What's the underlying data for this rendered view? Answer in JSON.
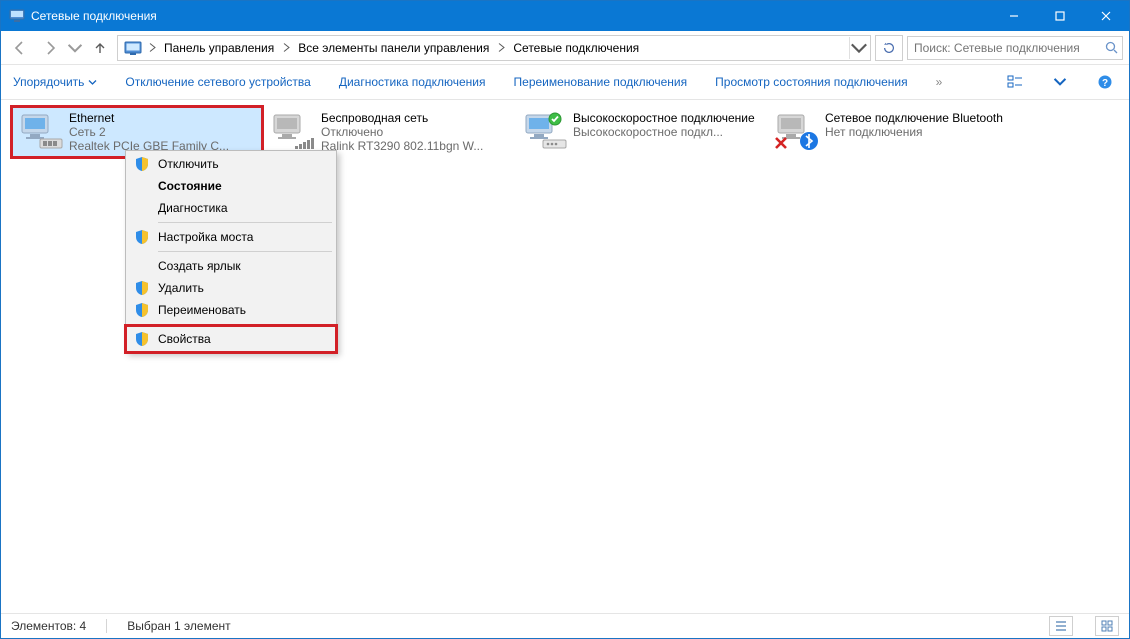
{
  "window": {
    "title": "Сетевые подключения"
  },
  "breadcrumb": {
    "item1": "Панель управления",
    "item2": "Все элементы панели управления",
    "item3": "Сетевые подключения"
  },
  "search": {
    "placeholder": "Поиск: Сетевые подключения"
  },
  "commands": {
    "organize": "Упорядочить",
    "disable": "Отключение сетевого устройства",
    "diagnose": "Диагностика подключения",
    "rename": "Переименование подключения",
    "status": "Просмотр состояния подключения"
  },
  "connections": [
    {
      "name": "Ethernet",
      "line2": "Сеть  2",
      "line3": "Realtek PCIe GBE Family C..."
    },
    {
      "name": "Беспроводная сеть",
      "line2": "Отключено",
      "line3": "Ralink RT3290 802.11bgn W..."
    },
    {
      "name": "Высокоскоростное подключение",
      "line2_alt": "",
      "line3": "Высокоскоростное подкл..."
    },
    {
      "name": "Сетевое подключение Bluetooth",
      "line2_alt": "",
      "line3": "Нет подключения"
    }
  ],
  "context_menu": {
    "disable": "Отключить",
    "status": "Состояние",
    "diagnose": "Диагностика",
    "bridge": "Настройка моста",
    "shortcut": "Создать ярлык",
    "delete": "Удалить",
    "rename": "Переименовать",
    "properties": "Свойства"
  },
  "statusbar": {
    "count": "Элементов: 4",
    "selection": "Выбран 1 элемент"
  }
}
